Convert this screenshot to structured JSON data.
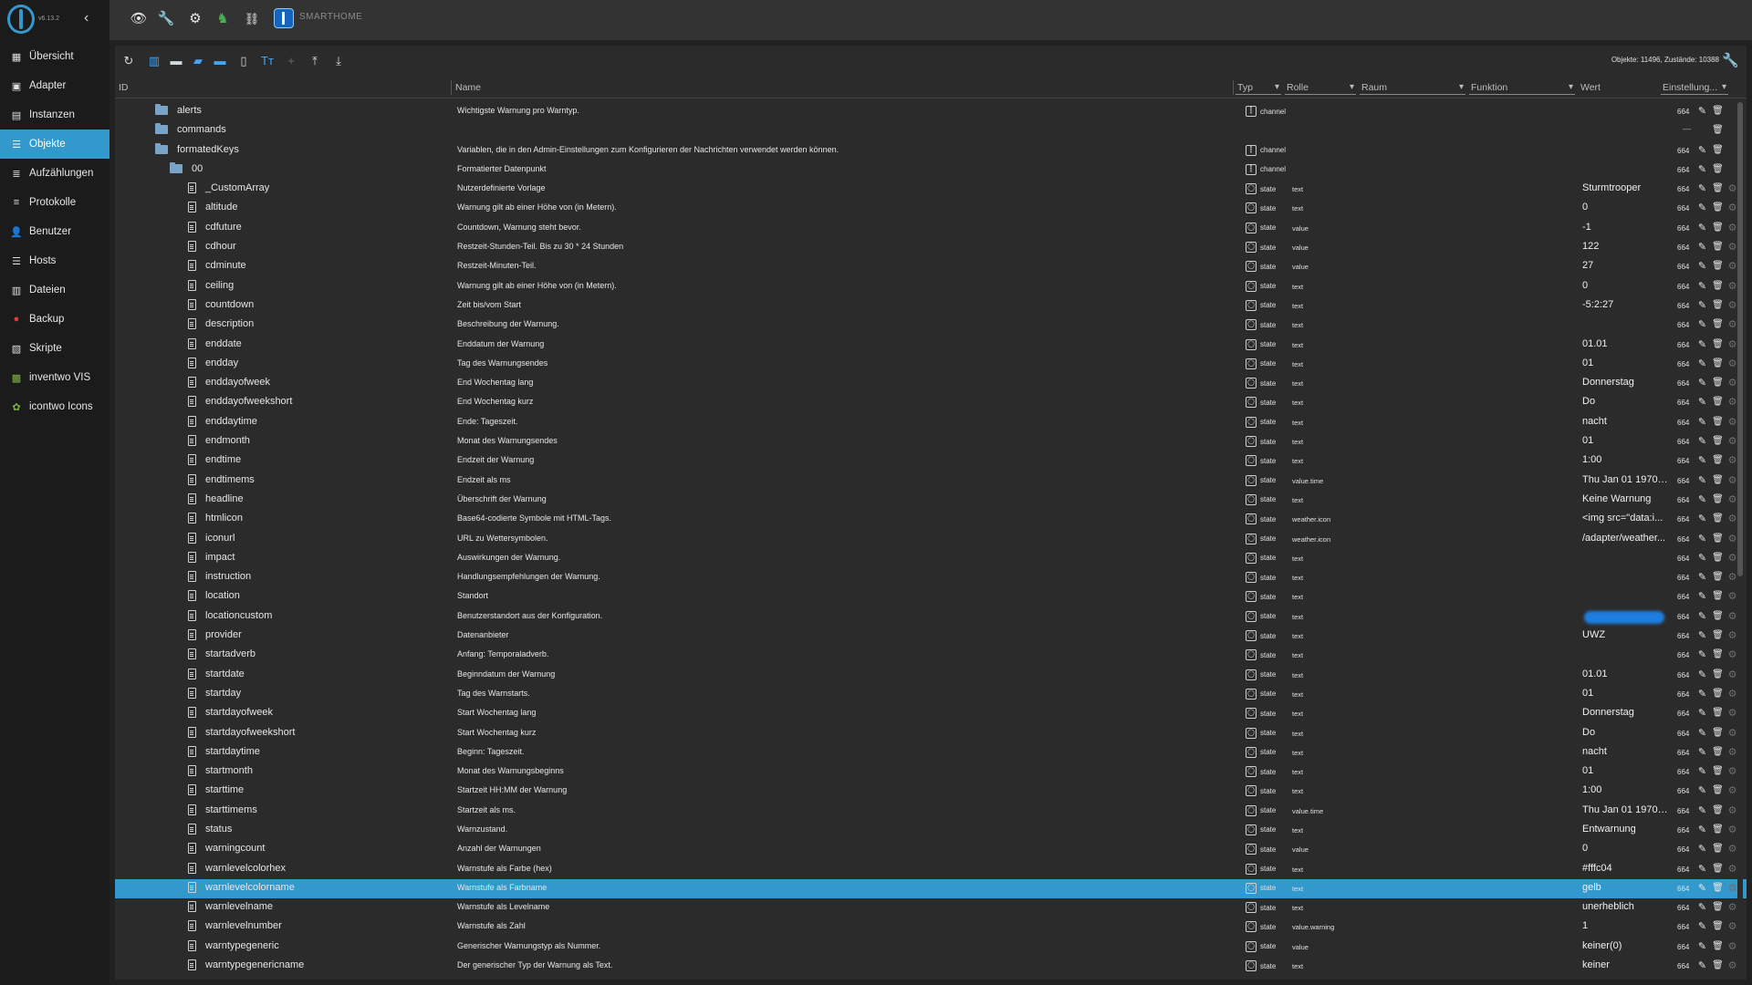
{
  "app": {
    "version": "v6.13.2",
    "brand": "SMARTHOME"
  },
  "sidebar": {
    "items": [
      {
        "label": "Übersicht",
        "icon": "grid-icon",
        "glyph": "▦"
      },
      {
        "label": "Adapter",
        "icon": "store-icon",
        "glyph": "▣"
      },
      {
        "label": "Instanzen",
        "icon": "instances-icon",
        "glyph": "▤"
      },
      {
        "label": "Objekte",
        "icon": "list-icon",
        "glyph": "☰",
        "active": true
      },
      {
        "label": "Aufzählungen",
        "icon": "enum-icon",
        "glyph": "≣"
      },
      {
        "label": "Protokolle",
        "icon": "log-icon",
        "glyph": "≡"
      },
      {
        "label": "Benutzer",
        "icon": "user-icon",
        "glyph": "👤"
      },
      {
        "label": "Hosts",
        "icon": "hosts-icon",
        "glyph": "☰"
      },
      {
        "label": "Dateien",
        "icon": "files-icon",
        "glyph": "▥"
      },
      {
        "label": "Backup",
        "icon": "backup-icon",
        "glyph": "●"
      },
      {
        "label": "Skripte",
        "icon": "scripts-icon",
        "glyph": "▧"
      },
      {
        "label": "inventwo VIS",
        "icon": "vis-icon",
        "glyph": "▩"
      },
      {
        "label": "icontwo Icons",
        "icon": "icons-icon",
        "glyph": "✿"
      }
    ]
  },
  "toolbar": {
    "counts": "Objekte: 11496, Zustände: 10388"
  },
  "columns": {
    "id": "ID",
    "name": "Name",
    "type": "Typ",
    "role": "Rolle",
    "room": "Raum",
    "function": "Funktion",
    "value": "Wert",
    "settings": "Einstellung..."
  },
  "rows": [
    {
      "id": "alerts",
      "kind": "folder",
      "level": 1,
      "name": "Wichtigste Warnung pro Warntyp.",
      "type": "channel",
      "role": "",
      "value": "",
      "acl": "664"
    },
    {
      "id": "commands",
      "kind": "folder",
      "level": 1,
      "name": "",
      "type": "",
      "role": "",
      "value": "—",
      "acl": ""
    },
    {
      "id": "formatedKeys",
      "kind": "folder",
      "level": 1,
      "name": "Variablen, die in den Admin-Einstellungen zum Konfigurieren der Nachrichten verwendet werden können.",
      "type": "channel",
      "role": "",
      "value": "",
      "acl": "664"
    },
    {
      "id": "00",
      "kind": "folder",
      "level": 2,
      "name": "Formatierter Datenpunkt",
      "type": "channel",
      "role": "",
      "value": "",
      "acl": "664"
    },
    {
      "id": "_CustomArray",
      "kind": "file",
      "level": 3,
      "name": "Nutzerdefinierte Vorlage",
      "type": "state",
      "role": "text",
      "value": "Sturmtrooper",
      "acl": "664"
    },
    {
      "id": "altitude",
      "kind": "file",
      "level": 3,
      "name": "Warnung gilt ab einer Höhe von (in Metern).",
      "type": "state",
      "role": "text",
      "value": "0",
      "acl": "664"
    },
    {
      "id": "cdfuture",
      "kind": "file",
      "level": 3,
      "name": "Countdown, Warnung steht bevor.",
      "type": "state",
      "role": "value",
      "value": "-1",
      "acl": "664"
    },
    {
      "id": "cdhour",
      "kind": "file",
      "level": 3,
      "name": "Restzeit-Stunden-Teil. Bis zu 30 * 24 Stunden",
      "type": "state",
      "role": "value",
      "value": "122",
      "acl": "664"
    },
    {
      "id": "cdminute",
      "kind": "file",
      "level": 3,
      "name": "Restzeit-Minuten-Teil.",
      "type": "state",
      "role": "value",
      "value": "27",
      "acl": "664"
    },
    {
      "id": "ceiling",
      "kind": "file",
      "level": 3,
      "name": "Warnung gilt ab einer Höhe von (in Metern).",
      "type": "state",
      "role": "text",
      "value": "0",
      "acl": "664"
    },
    {
      "id": "countdown",
      "kind": "file",
      "level": 3,
      "name": "Zeit bis/vom Start",
      "type": "state",
      "role": "text",
      "value": "-5:2:27",
      "acl": "664"
    },
    {
      "id": "description",
      "kind": "file",
      "level": 3,
      "name": "Beschreibung der Warnung.",
      "type": "state",
      "role": "text",
      "value": "",
      "acl": "664"
    },
    {
      "id": "enddate",
      "kind": "file",
      "level": 3,
      "name": "Enddatum der Warnung",
      "type": "state",
      "role": "text",
      "value": "01.01",
      "acl": "664"
    },
    {
      "id": "endday",
      "kind": "file",
      "level": 3,
      "name": "Tag des Warnungsendes",
      "type": "state",
      "role": "text",
      "value": "01",
      "acl": "664"
    },
    {
      "id": "enddayofweek",
      "kind": "file",
      "level": 3,
      "name": "End Wochentag lang",
      "type": "state",
      "role": "text",
      "value": "Donnerstag",
      "acl": "664"
    },
    {
      "id": "enddayofweekshort",
      "kind": "file",
      "level": 3,
      "name": "End Wochentag kurz",
      "type": "state",
      "role": "text",
      "value": "Do",
      "acl": "664"
    },
    {
      "id": "enddaytime",
      "kind": "file",
      "level": 3,
      "name": "Ende: Tageszeit.",
      "type": "state",
      "role": "text",
      "value": "nacht",
      "acl": "664"
    },
    {
      "id": "endmonth",
      "kind": "file",
      "level": 3,
      "name": "Monat des Warnungsendes",
      "type": "state",
      "role": "text",
      "value": "01",
      "acl": "664"
    },
    {
      "id": "endtime",
      "kind": "file",
      "level": 3,
      "name": "Endzeit der Warnung",
      "type": "state",
      "role": "text",
      "value": "1:00",
      "acl": "664"
    },
    {
      "id": "endtimems",
      "kind": "file",
      "level": 3,
      "name": "Endzeit als ms",
      "type": "state",
      "role": "value.time",
      "value": "Thu Jan 01 1970 0...",
      "acl": "664"
    },
    {
      "id": "headline",
      "kind": "file",
      "level": 3,
      "name": "Überschrift der Warnung",
      "type": "state",
      "role": "text",
      "value": "Keine Warnung",
      "acl": "664"
    },
    {
      "id": "htmlicon",
      "kind": "file",
      "level": 3,
      "name": "Base64-codierte Symbole mit HTML-Tags.",
      "type": "state",
      "role": "weather.icon",
      "value": "<img src=\"data:i...",
      "acl": "664"
    },
    {
      "id": "iconurl",
      "kind": "file",
      "level": 3,
      "name": "URL zu Wettersymbolen.",
      "type": "state",
      "role": "weather.icon",
      "value": "/adapter/weather...",
      "acl": "664"
    },
    {
      "id": "impact",
      "kind": "file",
      "level": 3,
      "name": "Auswirkungen der Warnung.",
      "type": "state",
      "role": "text",
      "value": "",
      "acl": "664"
    },
    {
      "id": "instruction",
      "kind": "file",
      "level": 3,
      "name": "Handlungsempfehlungen der Warnung.",
      "type": "state",
      "role": "text",
      "value": "",
      "acl": "664"
    },
    {
      "id": "location",
      "kind": "file",
      "level": 3,
      "name": "Standort",
      "type": "state",
      "role": "text",
      "value": "",
      "acl": "664"
    },
    {
      "id": "locationcustom",
      "kind": "file",
      "level": 3,
      "name": "Benutzerstandort aus der Konfiguration.",
      "type": "state",
      "role": "text",
      "value": "",
      "redacted": true,
      "acl": "664"
    },
    {
      "id": "provider",
      "kind": "file",
      "level": 3,
      "name": "Datenanbieter",
      "type": "state",
      "role": "text",
      "value": "UWZ",
      "acl": "664"
    },
    {
      "id": "startadverb",
      "kind": "file",
      "level": 3,
      "name": "Anfang: Temporaladverb.",
      "type": "state",
      "role": "text",
      "value": "",
      "acl": "664"
    },
    {
      "id": "startdate",
      "kind": "file",
      "level": 3,
      "name": "Beginndatum der Warnung",
      "type": "state",
      "role": "text",
      "value": "01.01",
      "acl": "664"
    },
    {
      "id": "startday",
      "kind": "file",
      "level": 3,
      "name": "Tag des Warnstarts.",
      "type": "state",
      "role": "text",
      "value": "01",
      "acl": "664"
    },
    {
      "id": "startdayofweek",
      "kind": "file",
      "level": 3,
      "name": "Start Wochentag lang",
      "type": "state",
      "role": "text",
      "value": "Donnerstag",
      "acl": "664"
    },
    {
      "id": "startdayofweekshort",
      "kind": "file",
      "level": 3,
      "name": "Start Wochentag kurz",
      "type": "state",
      "role": "text",
      "value": "Do",
      "acl": "664"
    },
    {
      "id": "startdaytime",
      "kind": "file",
      "level": 3,
      "name": "Beginn: Tageszeit.",
      "type": "state",
      "role": "text",
      "value": "nacht",
      "acl": "664"
    },
    {
      "id": "startmonth",
      "kind": "file",
      "level": 3,
      "name": "Monat des Warnungsbeginns",
      "type": "state",
      "role": "text",
      "value": "01",
      "acl": "664"
    },
    {
      "id": "starttime",
      "kind": "file",
      "level": 3,
      "name": "Startzeit HH:MM der Warnung",
      "type": "state",
      "role": "text",
      "value": "1:00",
      "acl": "664"
    },
    {
      "id": "starttimems",
      "kind": "file",
      "level": 3,
      "name": "Startzeit als ms.",
      "type": "state",
      "role": "value.time",
      "value": "Thu Jan 01 1970 0...",
      "acl": "664"
    },
    {
      "id": "status",
      "kind": "file",
      "level": 3,
      "name": "Warnzustand.",
      "type": "state",
      "role": "text",
      "value": "Entwarnung",
      "acl": "664"
    },
    {
      "id": "warningcount",
      "kind": "file",
      "level": 3,
      "name": "Anzahl der Warnungen",
      "type": "state",
      "role": "value",
      "value": "0",
      "acl": "664"
    },
    {
      "id": "warnlevelcolorhex",
      "kind": "file",
      "level": 3,
      "name": "Warnstufe als Farbe (hex)",
      "type": "state",
      "role": "text",
      "value": "#fffc04",
      "acl": "664"
    },
    {
      "id": "warnlevelcolorname",
      "kind": "file",
      "level": 3,
      "name": "Warnstufe als Farbname",
      "type": "state",
      "role": "text",
      "value": "gelb",
      "selected": true,
      "acl": "664"
    },
    {
      "id": "warnlevelname",
      "kind": "file",
      "level": 3,
      "name": "Warnstufe als Levelname",
      "type": "state",
      "role": "text",
      "value": "unerheblich",
      "acl": "664"
    },
    {
      "id": "warnlevelnumber",
      "kind": "file",
      "level": 3,
      "name": "Warnstufe als Zahl",
      "type": "state",
      "role": "value.warning",
      "value": "1",
      "acl": "664"
    },
    {
      "id": "warntypegeneric",
      "kind": "file",
      "level": 3,
      "name": "Generischer Warnungstyp als Nummer.",
      "type": "state",
      "role": "value",
      "value": "keiner(0)",
      "acl": "664"
    },
    {
      "id": "warntypegenericname",
      "kind": "file",
      "level": 3,
      "name": "Der generischer Typ der Warnung als Text.",
      "type": "state",
      "role": "text",
      "value": "keiner",
      "acl": "664"
    }
  ]
}
